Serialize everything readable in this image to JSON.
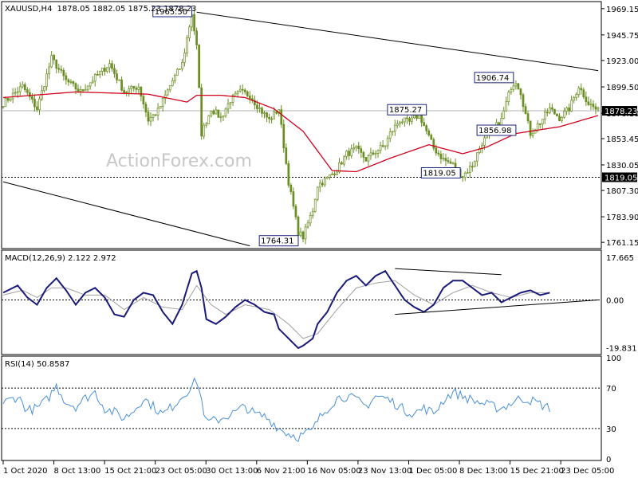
{
  "header": {
    "symbol": "XAUUSD,H4",
    "ohlc": "1878.05 1882.05 1875.23 1878.23"
  },
  "watermark": "ActionForex.com",
  "colors": {
    "candle": "#6b8e23",
    "ma": "#d0021b",
    "macd": "#1a1a7a",
    "signal": "#a0a0a0",
    "rsi": "#4a90d9",
    "label_border": "#1a237e"
  },
  "chart_data": [
    {
      "type": "candlestick",
      "title": "XAUUSD,H4 1878.05 1882.05 1875.23 1878.23",
      "y_ticks": [
        "1969.15",
        "1945.75",
        "1923.00",
        "1899.50",
        "1876.10",
        "1853.45",
        "1830.05",
        "1807.30",
        "1783.90",
        "1761.15"
      ],
      "ylim": [
        1757,
        1974
      ],
      "current_price": "1878.23",
      "support_level": "1819.05",
      "annotations": [
        {
          "label": "1965.50",
          "x_index": 78,
          "value": 1965.5
        },
        {
          "label": "1875.27",
          "x_index": 175,
          "value": 1875.27
        },
        {
          "label": "1906.74",
          "x_index": 211,
          "value": 1906.74
        },
        {
          "label": "1856.98",
          "x_index": 212,
          "value": 1856.98
        },
        {
          "label": "1819.05",
          "x_index": 189,
          "value": 1819.05
        },
        {
          "label": "1764.31",
          "x_index": 122,
          "value": 1764.31
        }
      ],
      "trend_lines": [
        {
          "from": [
            80,
            1966
          ],
          "to": [
            246,
            1914
          ]
        },
        {
          "from": [
            0,
            1815
          ],
          "to": [
            102,
            1758
          ]
        }
      ],
      "keypoints": [
        [
          0,
          1885
        ],
        [
          8,
          1900
        ],
        [
          14,
          1880
        ],
        [
          20,
          1925
        ],
        [
          26,
          1905
        ],
        [
          32,
          1895
        ],
        [
          38,
          1908
        ],
        [
          44,
          1920
        ],
        [
          50,
          1895
        ],
        [
          56,
          1900
        ],
        [
          60,
          1870
        ],
        [
          64,
          1878
        ],
        [
          70,
          1905
        ],
        [
          74,
          1920
        ],
        [
          78,
          1965
        ],
        [
          80,
          1935
        ],
        [
          82,
          1858
        ],
        [
          86,
          1880
        ],
        [
          90,
          1872
        ],
        [
          94,
          1888
        ],
        [
          98,
          1895
        ],
        [
          102,
          1892
        ],
        [
          106,
          1880
        ],
        [
          110,
          1870
        ],
        [
          114,
          1880
        ],
        [
          118,
          1815
        ],
        [
          122,
          1770
        ],
        [
          124,
          1766
        ],
        [
          128,
          1790
        ],
        [
          130,
          1812
        ],
        [
          134,
          1818
        ],
        [
          138,
          1826
        ],
        [
          142,
          1840
        ],
        [
          146,
          1844
        ],
        [
          150,
          1835
        ],
        [
          154,
          1842
        ],
        [
          158,
          1848
        ],
        [
          160,
          1858
        ],
        [
          164,
          1870
        ],
        [
          168,
          1868
        ],
        [
          172,
          1875
        ],
        [
          174,
          1865
        ],
        [
          178,
          1845
        ],
        [
          182,
          1835
        ],
        [
          186,
          1830
        ],
        [
          190,
          1820
        ],
        [
          194,
          1830
        ],
        [
          198,
          1850
        ],
        [
          202,
          1860
        ],
        [
          206,
          1870
        ],
        [
          208,
          1885
        ],
        [
          210,
          1900
        ],
        [
          212,
          1905
        ],
        [
          214,
          1895
        ],
        [
          216,
          1875
        ],
        [
          218,
          1858
        ],
        [
          222,
          1868
        ],
        [
          226,
          1880
        ],
        [
          230,
          1872
        ],
        [
          234,
          1880
        ],
        [
          238,
          1900
        ],
        [
          242,
          1885
        ],
        [
          246,
          1878
        ]
      ],
      "ma_keypoints": [
        [
          0,
          1890
        ],
        [
          30,
          1895
        ],
        [
          60,
          1893
        ],
        [
          76,
          1886
        ],
        [
          80,
          1892
        ],
        [
          90,
          1892
        ],
        [
          100,
          1890
        ],
        [
          112,
          1880
        ],
        [
          124,
          1860
        ],
        [
          136,
          1825
        ],
        [
          146,
          1824
        ],
        [
          160,
          1836
        ],
        [
          176,
          1848
        ],
        [
          190,
          1840
        ],
        [
          200,
          1846
        ],
        [
          212,
          1858
        ],
        [
          230,
          1864
        ],
        [
          246,
          1874
        ]
      ]
    },
    {
      "type": "line",
      "title": "MACD(12,26,9) 2.122 2.972",
      "y_ticks": [
        "17.665",
        "0.00",
        "-19.831"
      ],
      "ylim": [
        -22,
        20
      ],
      "zero_line": true,
      "keypoints": [
        [
          0,
          3
        ],
        [
          6,
          6
        ],
        [
          10,
          1
        ],
        [
          14,
          -2
        ],
        [
          18,
          5
        ],
        [
          22,
          9
        ],
        [
          26,
          4
        ],
        [
          30,
          -2
        ],
        [
          34,
          3
        ],
        [
          38,
          5
        ],
        [
          42,
          1
        ],
        [
          46,
          -6
        ],
        [
          50,
          -7
        ],
        [
          54,
          0
        ],
        [
          58,
          3
        ],
        [
          62,
          2
        ],
        [
          66,
          -5
        ],
        [
          70,
          -10
        ],
        [
          74,
          -2
        ],
        [
          78,
          11
        ],
        [
          80,
          12
        ],
        [
          82,
          5
        ],
        [
          84,
          -8
        ],
        [
          88,
          -10
        ],
        [
          92,
          -7
        ],
        [
          96,
          -3
        ],
        [
          100,
          0
        ],
        [
          104,
          -2
        ],
        [
          108,
          -5
        ],
        [
          112,
          -6
        ],
        [
          114,
          -12
        ],
        [
          118,
          -16
        ],
        [
          122,
          -20
        ],
        [
          124,
          -19
        ],
        [
          128,
          -16
        ],
        [
          130,
          -10
        ],
        [
          134,
          -5
        ],
        [
          138,
          3
        ],
        [
          142,
          8
        ],
        [
          146,
          10
        ],
        [
          150,
          6
        ],
        [
          154,
          10
        ],
        [
          158,
          12
        ],
        [
          162,
          6
        ],
        [
          166,
          0
        ],
        [
          170,
          -3
        ],
        [
          174,
          -5
        ],
        [
          178,
          -2
        ],
        [
          182,
          5
        ],
        [
          186,
          8
        ],
        [
          190,
          8
        ],
        [
          194,
          5
        ],
        [
          198,
          2
        ],
        [
          202,
          3
        ],
        [
          206,
          -1
        ],
        [
          210,
          1
        ],
        [
          214,
          3
        ],
        [
          218,
          4
        ],
        [
          222,
          2
        ],
        [
          226,
          3
        ]
      ],
      "signal_keypoints": [
        [
          0,
          2
        ],
        [
          8,
          4
        ],
        [
          14,
          1
        ],
        [
          20,
          5
        ],
        [
          26,
          5
        ],
        [
          34,
          2
        ],
        [
          42,
          2
        ],
        [
          50,
          -4
        ],
        [
          58,
          1
        ],
        [
          66,
          -3
        ],
        [
          74,
          -4
        ],
        [
          80,
          6
        ],
        [
          86,
          -2
        ],
        [
          92,
          -6
        ],
        [
          100,
          -2
        ],
        [
          110,
          -4
        ],
        [
          118,
          -10
        ],
        [
          124,
          -16
        ],
        [
          130,
          -14
        ],
        [
          138,
          -4
        ],
        [
          146,
          5
        ],
        [
          154,
          7
        ],
        [
          162,
          8
        ],
        [
          170,
          2
        ],
        [
          178,
          -2
        ],
        [
          186,
          3
        ],
        [
          194,
          6
        ],
        [
          202,
          3
        ],
        [
          210,
          1
        ],
        [
          218,
          3
        ],
        [
          226,
          3
        ]
      ],
      "annotation_lines": [
        {
          "from": [
            162,
            13
          ],
          "to": [
            206,
            10.5
          ]
        },
        {
          "from": [
            162,
            -6
          ],
          "to": [
            246,
            0
          ]
        }
      ]
    },
    {
      "type": "line",
      "title": "RSI(14) 50.8587",
      "y_ticks": [
        "100",
        "70",
        "30",
        "0"
      ],
      "ylim": [
        0,
        100
      ],
      "levels": [
        70,
        30
      ],
      "keypoints": [
        [
          0,
          55
        ],
        [
          6,
          62
        ],
        [
          10,
          48
        ],
        [
          14,
          50
        ],
        [
          18,
          58
        ],
        [
          22,
          72
        ],
        [
          26,
          56
        ],
        [
          30,
          52
        ],
        [
          34,
          60
        ],
        [
          38,
          66
        ],
        [
          42,
          50
        ],
        [
          46,
          46
        ],
        [
          50,
          40
        ],
        [
          54,
          48
        ],
        [
          58,
          60
        ],
        [
          62,
          52
        ],
        [
          66,
          44
        ],
        [
          70,
          52
        ],
        [
          74,
          62
        ],
        [
          78,
          72
        ],
        [
          80,
          78
        ],
        [
          82,
          58
        ],
        [
          84,
          36
        ],
        [
          88,
          38
        ],
        [
          92,
          42
        ],
        [
          96,
          46
        ],
        [
          100,
          52
        ],
        [
          104,
          44
        ],
        [
          108,
          42
        ],
        [
          112,
          35
        ],
        [
          114,
          30
        ],
        [
          118,
          25
        ],
        [
          122,
          22
        ],
        [
          124,
          24
        ],
        [
          128,
          28
        ],
        [
          130,
          38
        ],
        [
          134,
          50
        ],
        [
          138,
          60
        ],
        [
          142,
          62
        ],
        [
          146,
          58
        ],
        [
          150,
          52
        ],
        [
          154,
          62
        ],
        [
          158,
          60
        ],
        [
          162,
          55
        ],
        [
          166,
          48
        ],
        [
          170,
          45
        ],
        [
          174,
          50
        ],
        [
          178,
          45
        ],
        [
          182,
          58
        ],
        [
          186,
          66
        ],
        [
          190,
          62
        ],
        [
          194,
          58
        ],
        [
          198,
          55
        ],
        [
          202,
          52
        ],
        [
          206,
          50
        ],
        [
          210,
          55
        ],
        [
          214,
          60
        ],
        [
          218,
          58
        ],
        [
          222,
          54
        ],
        [
          226,
          50
        ]
      ]
    }
  ],
  "x_axis": {
    "labels": [
      "1 Oct 2020",
      "8 Oct 13:00",
      "15 Oct 21:00",
      "23 Oct 05:00",
      "30 Oct 13:00",
      "6 Nov 21:00",
      "16 Nov 05:00",
      "23 Nov 13:00",
      "1 Dec 05:00",
      "8 Dec 13:00",
      "15 Dec 21:00",
      "23 Dec 05:00"
    ]
  }
}
